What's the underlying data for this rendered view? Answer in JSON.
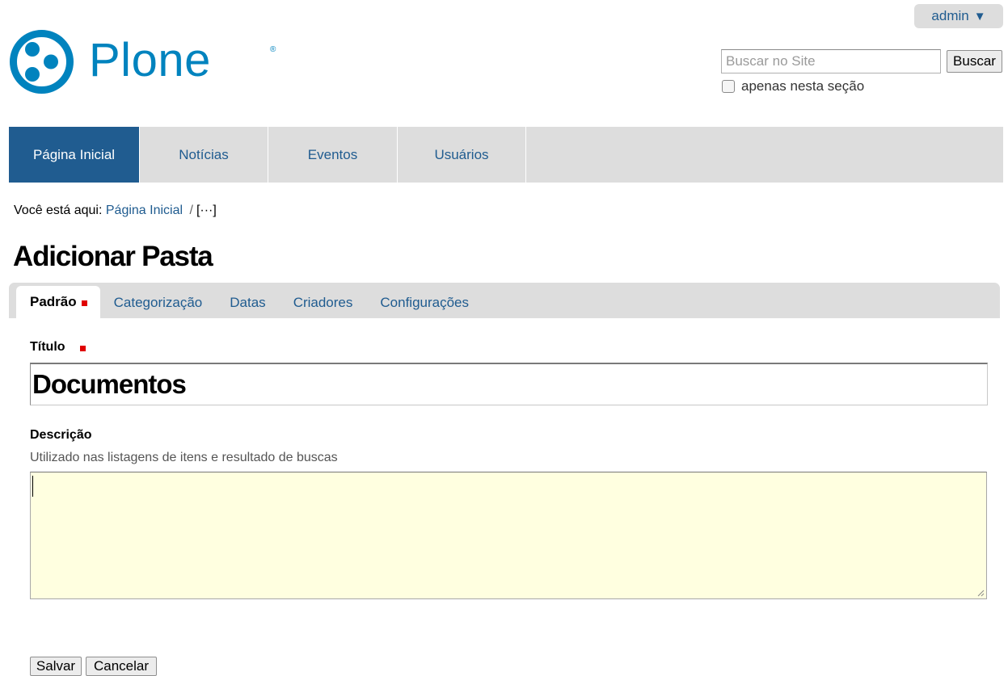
{
  "header": {
    "user_menu": {
      "label": "admin",
      "icon": "caret-down-icon"
    },
    "logo": {
      "text": "Plone",
      "registered_mark": "®",
      "color": "#0083be"
    },
    "search": {
      "placeholder": "Buscar no Site",
      "value": "",
      "button_label": "Buscar",
      "section_only_label": "apenas nesta seção",
      "section_only_checked": false
    }
  },
  "nav": {
    "items": [
      {
        "label": "Página Inicial",
        "active": true
      },
      {
        "label": "Notícias",
        "active": false
      },
      {
        "label": "Eventos",
        "active": false
      },
      {
        "label": "Usuários",
        "active": false
      }
    ]
  },
  "breadcrumb": {
    "prefix": "Você está aqui:",
    "home": "Página Inicial",
    "separator": "/",
    "current": "[···]"
  },
  "page": {
    "title": "Adicionar Pasta"
  },
  "tabs": [
    {
      "label": "Padrão",
      "active": true,
      "required": true
    },
    {
      "label": "Categorização",
      "active": false
    },
    {
      "label": "Datas",
      "active": false
    },
    {
      "label": "Criadores",
      "active": false
    },
    {
      "label": "Configurações",
      "active": false
    }
  ],
  "form": {
    "title_label": "Título",
    "title_value": "Documentos",
    "description_label": "Descrição",
    "description_help": "Utilizado nas listagens de itens e resultado de buscas",
    "description_value": "",
    "save_label": "Salvar",
    "cancel_label": "Cancelar"
  },
  "colors": {
    "link": "#205c90",
    "nav_active_bg": "#205c90",
    "nav_bg": "#dddddd",
    "required_marker": "#e00000",
    "description_bg": "#ffffe0"
  }
}
